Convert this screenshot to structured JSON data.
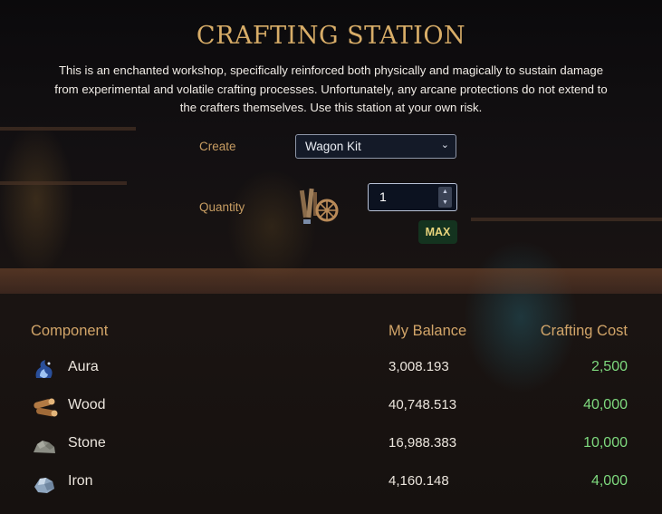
{
  "header": {
    "title": "CRAFTING STATION",
    "description": "This is an enchanted workshop, specifically reinforced both physically and magically to sustain damage from experimental and volatile crafting processes. Unfortunately, any arcane protections do not extend to the crafters themselves. Use this station at your own risk."
  },
  "form": {
    "create_label": "Create",
    "create_selected": "Wagon Kit",
    "quantity_label": "Quantity",
    "quantity_value": "1",
    "max_label": "MAX",
    "item_icon": "wagon-kit-icon"
  },
  "table": {
    "headers": {
      "component": "Component",
      "balance": "My Balance",
      "cost": "Crafting Cost"
    },
    "rows": [
      {
        "icon": "aura-icon",
        "name": "Aura",
        "balance": "3,008.193",
        "cost": "2,500"
      },
      {
        "icon": "wood-icon",
        "name": "Wood",
        "balance": "40,748.513",
        "cost": "40,000"
      },
      {
        "icon": "stone-icon",
        "name": "Stone",
        "balance": "16,988.383",
        "cost": "10,000"
      },
      {
        "icon": "iron-icon",
        "name": "Iron",
        "balance": "4,160.148",
        "cost": "4,000"
      }
    ]
  },
  "colors": {
    "title": "#d8ad68",
    "label": "#c79d62",
    "cost": "#7ed97e",
    "max_bg": "#14331f"
  }
}
